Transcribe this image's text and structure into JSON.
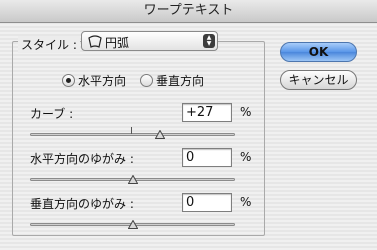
{
  "window": {
    "title": "ワープテキスト"
  },
  "style": {
    "label": "スタイル :",
    "value": "円弧",
    "icon": "arc-shape-icon"
  },
  "orientation": {
    "horizontal_label": "水平方向",
    "vertical_label": "垂直方向",
    "selected": "horizontal"
  },
  "bend": {
    "label": "カーブ :",
    "value": "+27",
    "unit": "%",
    "slider_fraction": 0.635
  },
  "horizontal_distortion": {
    "label": "水平方向のゆがみ :",
    "value": "0",
    "unit": "%",
    "slider_fraction": 0.5
  },
  "vertical_distortion": {
    "label": "垂直方向のゆがみ :",
    "value": "0",
    "unit": "%",
    "slider_fraction": 0.5
  },
  "buttons": {
    "ok": "OK",
    "cancel": "キャンセル"
  }
}
